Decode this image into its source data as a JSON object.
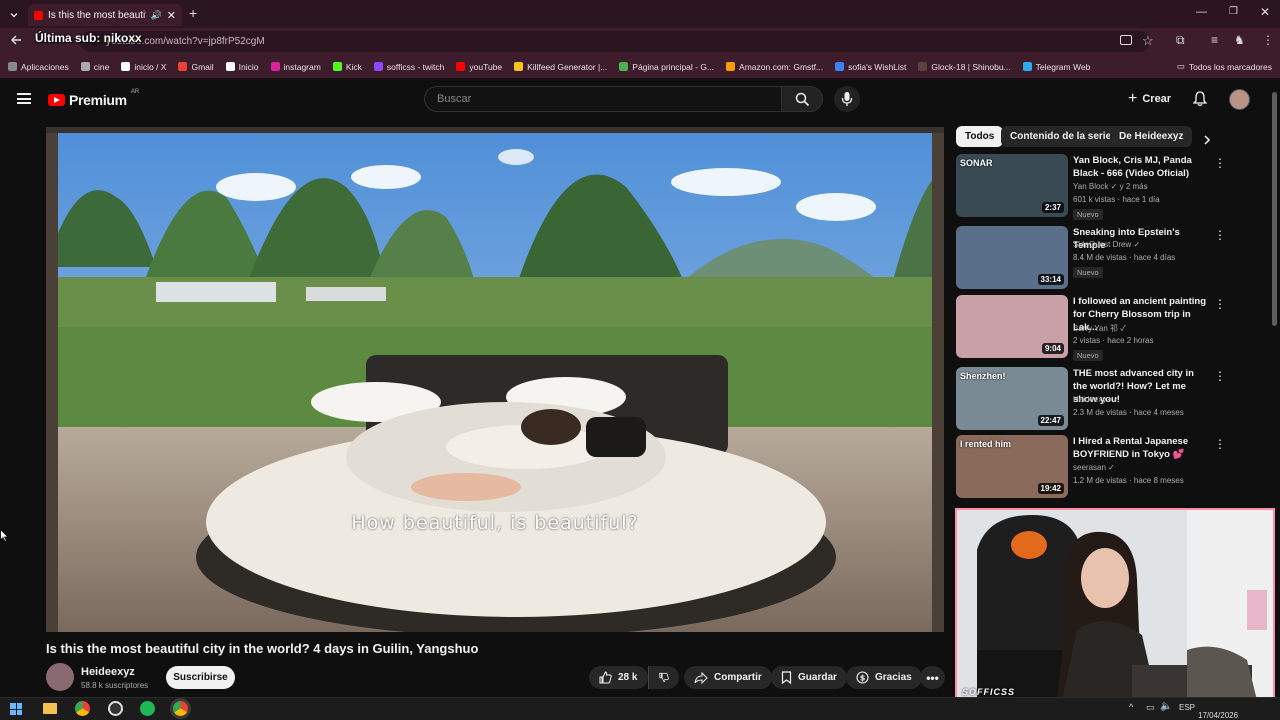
{
  "browser": {
    "tab_title": "Is this the most beautiful ci",
    "url": "youtube.com/watch?v=jp8frP52cgM",
    "overlay_text": "Última sub: nikoxx",
    "bookmarks": [
      {
        "label": "Aplicaciones",
        "color": "#888888"
      },
      {
        "label": "cine",
        "color": "#aaaaaa"
      },
      {
        "label": "inicio / X",
        "color": "#ffffff"
      },
      {
        "label": "Gmail",
        "color": "#ea4335"
      },
      {
        "label": "Inicio",
        "color": "#ffffff"
      },
      {
        "label": "instagram",
        "color": "#d6249f"
      },
      {
        "label": "Kick",
        "color": "#53fc18"
      },
      {
        "label": "sofficss - twitch",
        "color": "#9146ff"
      },
      {
        "label": "youTube",
        "color": "#ff0000"
      },
      {
        "label": "Killfeed Generator |...",
        "color": "#f5c518"
      },
      {
        "label": "Página principal - G...",
        "color": "#4caf50"
      },
      {
        "label": "Amazon.com: Gmstf...",
        "color": "#ff9900"
      },
      {
        "label": "sofia's WishList",
        "color": "#3b82f6"
      },
      {
        "label": "Glock-18 | Shinobu...",
        "color": "#5d4037"
      },
      {
        "label": "Telegram Web",
        "color": "#2aabee"
      }
    ],
    "bookmarks_all": "Todos los marcadores"
  },
  "youtube": {
    "logo_text": "Premium",
    "region": "AR",
    "search_placeholder": "Buscar",
    "create_label": "Crear",
    "video": {
      "subtitle": "How beautiful, is beautiful?",
      "title": "Is this the most beautiful city in the world? 4 days in Guilin, Yangshuo",
      "channel": "Heideexyz",
      "subscribers": "58.8 k suscriptores",
      "subscribe_label": "Suscribirse",
      "likes": "28 k",
      "share_label": "Compartir",
      "save_label": "Guardar",
      "thanks_label": "Gracias"
    },
    "chips": [
      "Todos",
      "Contenido de la serie",
      "De Heideexyz"
    ],
    "recommendations": [
      {
        "title": "Yan Block, Cris MJ, Panda Black - 666 (Video Oficial)",
        "channel": "Yan Block",
        "extra": "y 2 más",
        "meta": "601 k vistas · hace 1 día",
        "duration": "2:37",
        "badge": "Nuevo",
        "thumb_label": "SONAR",
        "thumb_color": "#3a4a55"
      },
      {
        "title": "Sneaking into Epstein's Temple",
        "channel": "SideQuest Drew",
        "meta": "8.4 M de vistas · hace 4 días",
        "duration": "33:14",
        "badge": "Nuevo",
        "thumb_color": "#5a6f8a"
      },
      {
        "title": "I followed an ancient painting for Cherry Blossom trip in Lak...",
        "channel": "Barry Yan 祁",
        "meta": "2 vistas · hace 2 horas",
        "duration": "9:04",
        "badge": "Nuevo",
        "thumb_color": "#c9a0a8"
      },
      {
        "title": "THE most advanced city in the world?! How? Let me show you!",
        "channel": "Heideexyz",
        "meta": "2.3 M de vistas · hace 4 meses",
        "duration": "22:47",
        "thumb_label": "Shenzhen!",
        "thumb_color": "#7a8a95"
      },
      {
        "title": "I Hired a Rental Japanese BOYFRIEND in Tokyo 💕",
        "channel": "seerasan",
        "meta": "1.2 M de vistas · hace 8 meses",
        "duration": "19:42",
        "thumb_label": "I rented him",
        "thumb_color": "#8a6a5a"
      }
    ]
  },
  "webcam": {
    "label": "SOFFICSS"
  },
  "taskbar": {
    "lang": "ESP",
    "date": "17/04/2026"
  }
}
